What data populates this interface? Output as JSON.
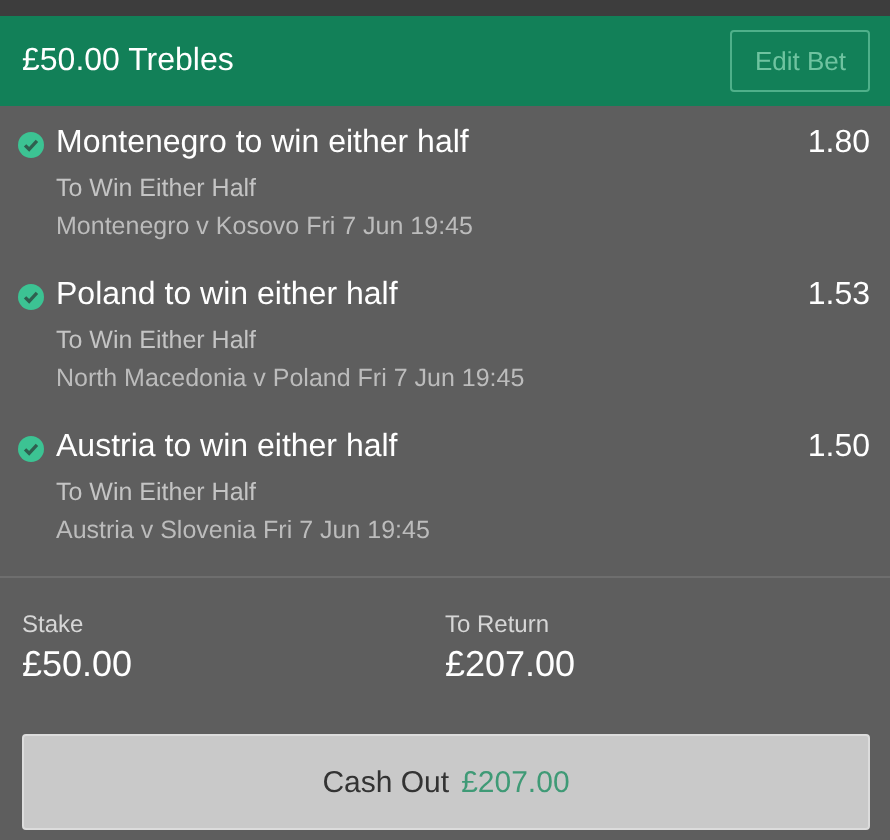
{
  "header": {
    "title": "£50.00 Trebles",
    "edit_button": "Edit Bet"
  },
  "selections": [
    {
      "name": "Montenegro to win either half",
      "odds": "1.80",
      "market": "To Win Either Half",
      "event": "Montenegro v Kosovo Fri 7 Jun 19:45",
      "won": true
    },
    {
      "name": "Poland to win either half",
      "odds": "1.53",
      "market": "To Win Either Half",
      "event": "North Macedonia v Poland Fri 7 Jun 19:45",
      "won": true
    },
    {
      "name": "Austria to win either half",
      "odds": "1.50",
      "market": "To Win Either Half",
      "event": "Austria v Slovenia Fri 7 Jun 19:45",
      "won": true
    }
  ],
  "summary": {
    "stake_label": "Stake",
    "stake": "£50.00",
    "return_label": "To Return",
    "return": "£207.00"
  },
  "cash_out": {
    "label": "Cash Out",
    "amount": "£207.00"
  }
}
